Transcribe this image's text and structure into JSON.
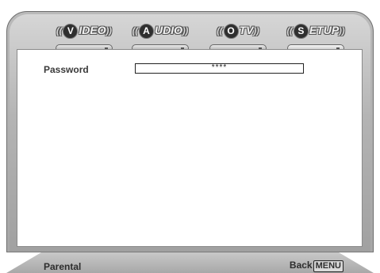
{
  "tabs": [
    {
      "icon_letter": "V",
      "label": "IDEO",
      "name": "video"
    },
    {
      "icon_letter": "A",
      "label": "UDIO",
      "name": "audio"
    },
    {
      "icon_letter": "O",
      "label": "TV",
      "name": "tv"
    },
    {
      "icon_letter": "S",
      "label": "ETUP",
      "name": "setup"
    }
  ],
  "tab_bracket_left": "((",
  "tab_bracket_right": "))",
  "panel": {
    "password_label": "Password",
    "password_value": "****"
  },
  "status_bar": {
    "left_text": "Parental",
    "back_label": "Back",
    "menu_key": "MENU"
  },
  "colors": {
    "frame": "#a6a6a6",
    "panel": "#ffffff",
    "text": "#3a3a3a"
  }
}
